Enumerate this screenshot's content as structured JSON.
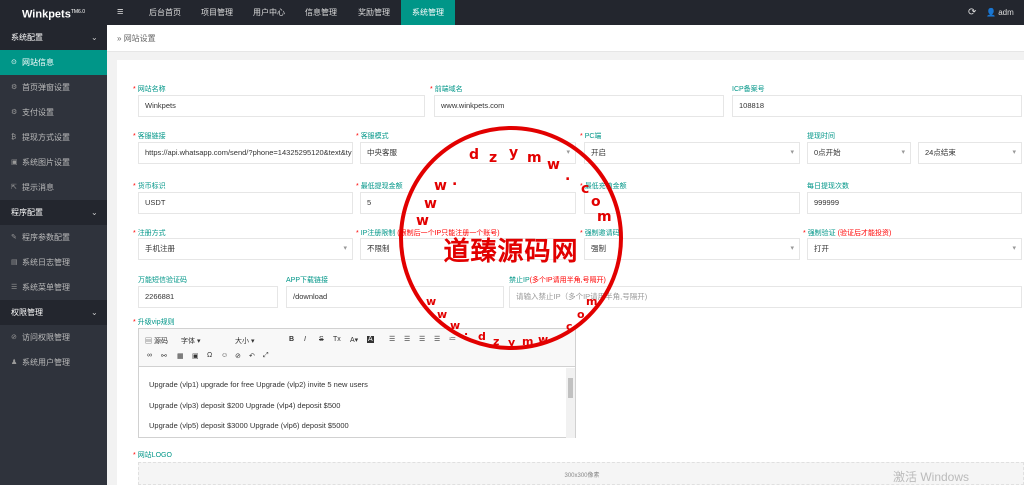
{
  "app": {
    "logo": "Winkpets",
    "logo_tm": "TM6.0",
    "user": "adm"
  },
  "topnav": [
    "后台首页",
    "项目管理",
    "用户中心",
    "信息管理",
    "奖励管理",
    "系统管理"
  ],
  "sidebar": [
    {
      "label": "系统配置",
      "type": "group"
    },
    {
      "label": "网站信息",
      "type": "item",
      "icon": "globe"
    },
    {
      "label": "首页弹窗设置",
      "type": "item",
      "icon": "gear"
    },
    {
      "label": "支付设置",
      "type": "item",
      "icon": "gear"
    },
    {
      "label": "提现方式设置",
      "type": "item",
      "icon": "bitcoin"
    },
    {
      "label": "系统图片设置",
      "type": "item",
      "icon": "image"
    },
    {
      "label": "提示消息",
      "type": "item",
      "icon": "export"
    },
    {
      "label": "程序配置",
      "type": "group"
    },
    {
      "label": "程序参数配置",
      "type": "item",
      "icon": "wrench"
    },
    {
      "label": "系统日志管理",
      "type": "item",
      "icon": "doc"
    },
    {
      "label": "系统菜单管理",
      "type": "item",
      "icon": "menu"
    },
    {
      "label": "权限管理",
      "type": "group"
    },
    {
      "label": "访问权限管理",
      "type": "item",
      "icon": "shield"
    },
    {
      "label": "系统用户管理",
      "type": "item",
      "icon": "user"
    }
  ],
  "breadcrumb": "网站设置",
  "form": {
    "site_name": {
      "label": "网站名称",
      "value": "Winkpets"
    },
    "domain": {
      "label": "前端域名",
      "value": "www.winkpets.com"
    },
    "icp": {
      "label": "ICP备案号",
      "value": "108818"
    },
    "cs_link": {
      "label": "客服链接",
      "value": "https://api.whatsapp.com/send/?phone=14325295120&text&type"
    },
    "cs_mode": {
      "label": "客服模式",
      "value": "中央客服"
    },
    "pc": {
      "label": "PC端",
      "value": "开启"
    },
    "withdraw_time": {
      "label": "提现时间",
      "start": "0点开始",
      "end": "24点结束"
    },
    "currency": {
      "label": "货币标识",
      "value": "USDT"
    },
    "min_withdraw": {
      "label": "最低提现金额",
      "value": "5"
    },
    "min_recharge": {
      "label": "最低充值金额",
      "value": ""
    },
    "daily_withdraw": {
      "label": "每日提现次数",
      "value": "999999"
    },
    "reg_mode": {
      "label": "注册方式",
      "value": "手机注册"
    },
    "ip_limit": {
      "label": "IP注册限制",
      "hint": "(限制后一个IP只能注册一个账号)",
      "value": "不限制"
    },
    "invite_code": {
      "label": "强制邀请码",
      "value": "强制"
    },
    "force_verify": {
      "label": "强制验证",
      "hint": "(验证后才能投资)",
      "value": "打开"
    },
    "universal_code": {
      "label": "万能短信验证码",
      "value": "2266881"
    },
    "app_link": {
      "label": "APP下载链接",
      "value": "/download"
    },
    "ban_ip": {
      "label": "禁止IP",
      "hint": "(多个IP请用半角,号隔开)",
      "placeholder": "请输入禁止IP（多个IP请用半角,号隔开)"
    },
    "vip_rules": {
      "label": "升级vip规则"
    },
    "site_logo": {
      "label": "网站LOGO",
      "size": "300x300像素"
    }
  },
  "editor": {
    "source": "源码",
    "font": "字体",
    "size": "大小",
    "lines": [
      "Upgrade (vlp1) upgrade for free Upgrade (vlp2) invite 5 new users",
      "Upgrade (vlp3) deposit $200 Upgrade (vlp4) deposit $500",
      "Upgrade (vlp5) deposit $3000 Upgrade (vlp6) deposit $5000"
    ]
  },
  "stamp": {
    "text": "道臻源码网",
    "url_chars": [
      "d",
      "z",
      "y",
      "m",
      "w",
      ".",
      "c",
      "o",
      "m"
    ]
  },
  "watermark": "激活 Windows",
  "colors": {
    "accent": "#009688",
    "topbar": "#23262e",
    "sidebar": "#2f333c",
    "stamp": "#e20000"
  }
}
